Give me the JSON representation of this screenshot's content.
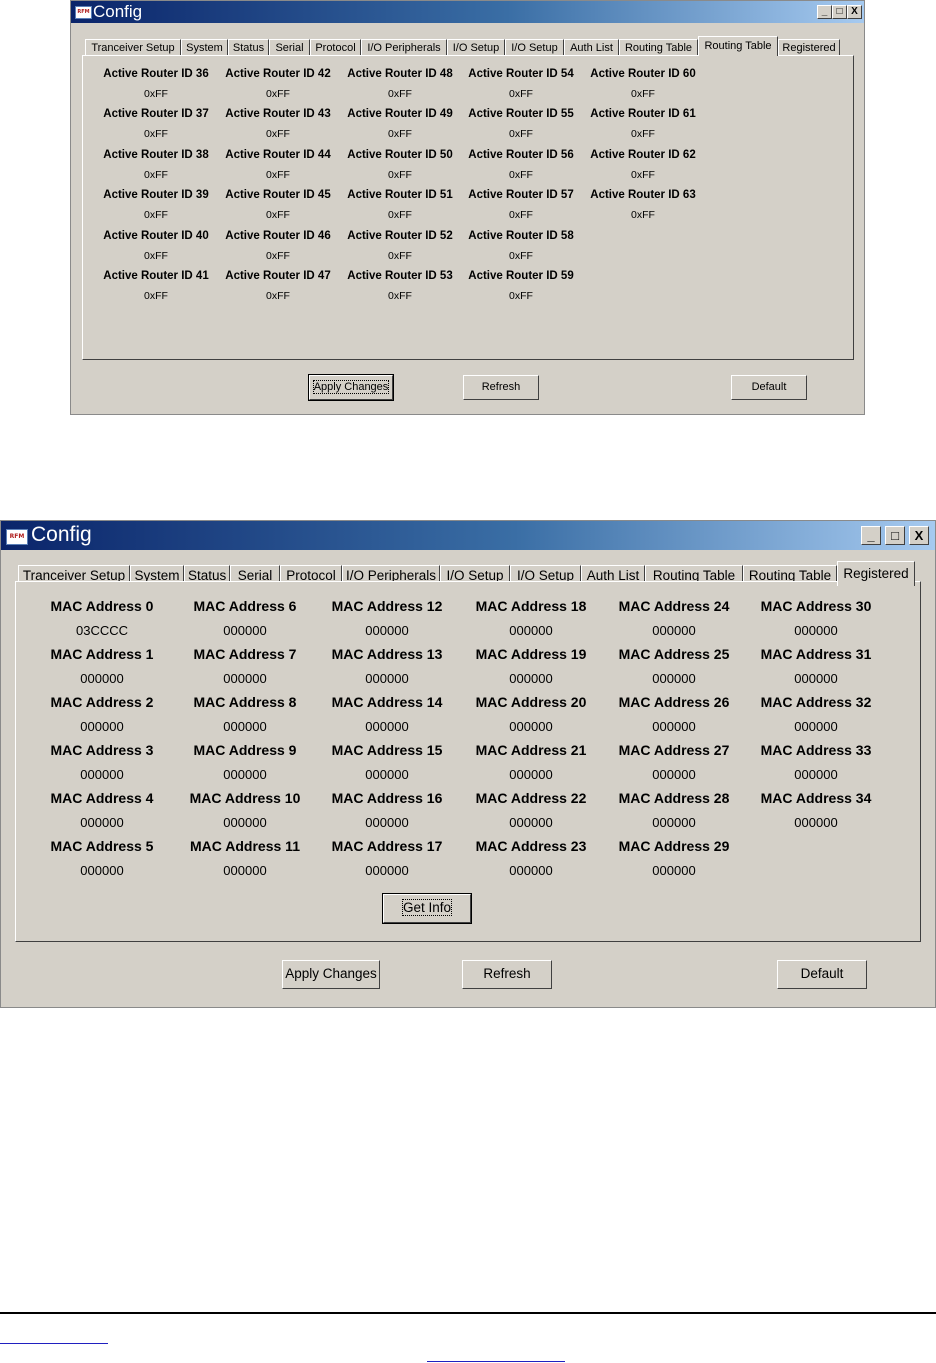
{
  "window1": {
    "title": "Config",
    "icon_label": "RFM",
    "controls": {
      "minimize": "_",
      "maximize": "□",
      "close": "X"
    },
    "tabs": [
      "Tranceiver Setup",
      "System",
      "Status",
      "Serial",
      "Protocol",
      "I/O Peripherals",
      "I/O Setup",
      "I/O Setup",
      "Auth List",
      "Routing Table",
      "Routing Table",
      "Registered"
    ],
    "active_tab_index": 10,
    "routers": [
      {
        "label": "Active Router ID 36",
        "value": "0xFF"
      },
      {
        "label": "Active Router ID 37",
        "value": "0xFF"
      },
      {
        "label": "Active Router ID 38",
        "value": "0xFF"
      },
      {
        "label": "Active Router ID 39",
        "value": "0xFF"
      },
      {
        "label": "Active Router ID 40",
        "value": "0xFF"
      },
      {
        "label": "Active Router ID 41",
        "value": "0xFF"
      },
      {
        "label": "Active Router ID 42",
        "value": "0xFF"
      },
      {
        "label": "Active Router ID 43",
        "value": "0xFF"
      },
      {
        "label": "Active Router ID 44",
        "value": "0xFF"
      },
      {
        "label": "Active Router ID 45",
        "value": "0xFF"
      },
      {
        "label": "Active Router ID 46",
        "value": "0xFF"
      },
      {
        "label": "Active Router ID 47",
        "value": "0xFF"
      },
      {
        "label": "Active Router ID 48",
        "value": "0xFF"
      },
      {
        "label": "Active Router ID 49",
        "value": "0xFF"
      },
      {
        "label": "Active Router ID 50",
        "value": "0xFF"
      },
      {
        "label": "Active Router ID 51",
        "value": "0xFF"
      },
      {
        "label": "Active Router ID 52",
        "value": "0xFF"
      },
      {
        "label": "Active Router ID 53",
        "value": "0xFF"
      },
      {
        "label": "Active Router ID 54",
        "value": "0xFF"
      },
      {
        "label": "Active Router ID 55",
        "value": "0xFF"
      },
      {
        "label": "Active Router ID 56",
        "value": "0xFF"
      },
      {
        "label": "Active Router ID 57",
        "value": "0xFF"
      },
      {
        "label": "Active Router ID 58",
        "value": "0xFF"
      },
      {
        "label": "Active Router ID 59",
        "value": "0xFF"
      },
      {
        "label": "Active Router ID 60",
        "value": "0xFF"
      },
      {
        "label": "Active Router ID 61",
        "value": "0xFF"
      },
      {
        "label": "Active Router ID 62",
        "value": "0xFF"
      },
      {
        "label": "Active Router ID 63",
        "value": "0xFF"
      }
    ],
    "buttons": {
      "apply": "Apply Changes",
      "refresh": "Refresh",
      "default": "Default"
    }
  },
  "window2": {
    "title": "Config",
    "icon_label": "RFM",
    "controls": {
      "minimize": "_",
      "maximize": "□",
      "close": "X"
    },
    "tabs": [
      "Tranceiver Setup",
      "System",
      "Status",
      "Serial",
      "Protocol",
      "I/O Peripherals",
      "I/O Setup",
      "I/O Setup",
      "Auth List",
      "Routing Table",
      "Routing Table",
      "Registered"
    ],
    "active_tab_index": 11,
    "macs": [
      {
        "label": "MAC Address 0",
        "value": "03CCCC"
      },
      {
        "label": "MAC Address 1",
        "value": "000000"
      },
      {
        "label": "MAC Address 2",
        "value": "000000"
      },
      {
        "label": "MAC Address 3",
        "value": "000000"
      },
      {
        "label": "MAC Address 4",
        "value": "000000"
      },
      {
        "label": "MAC Address 5",
        "value": "000000"
      },
      {
        "label": "MAC Address 6",
        "value": "000000"
      },
      {
        "label": "MAC Address 7",
        "value": "000000"
      },
      {
        "label": "MAC Address 8",
        "value": "000000"
      },
      {
        "label": "MAC Address 9",
        "value": "000000"
      },
      {
        "label": "MAC Address 10",
        "value": "000000"
      },
      {
        "label": "MAC Address 11",
        "value": "000000"
      },
      {
        "label": "MAC Address 12",
        "value": "000000"
      },
      {
        "label": "MAC Address 13",
        "value": "000000"
      },
      {
        "label": "MAC Address 14",
        "value": "000000"
      },
      {
        "label": "MAC Address 15",
        "value": "000000"
      },
      {
        "label": "MAC Address 16",
        "value": "000000"
      },
      {
        "label": "MAC Address 17",
        "value": "000000"
      },
      {
        "label": "MAC Address 18",
        "value": "000000"
      },
      {
        "label": "MAC Address 19",
        "value": "000000"
      },
      {
        "label": "MAC Address 20",
        "value": "000000"
      },
      {
        "label": "MAC Address 21",
        "value": "000000"
      },
      {
        "label": "MAC Address 22",
        "value": "000000"
      },
      {
        "label": "MAC Address 23",
        "value": "000000"
      },
      {
        "label": "MAC Address 24",
        "value": "000000"
      },
      {
        "label": "MAC Address 25",
        "value": "000000"
      },
      {
        "label": "MAC Address 26",
        "value": "000000"
      },
      {
        "label": "MAC Address 27",
        "value": "000000"
      },
      {
        "label": "MAC Address 28",
        "value": "000000"
      },
      {
        "label": "MAC Address 29",
        "value": "000000"
      },
      {
        "label": "MAC Address 30",
        "value": "000000"
      },
      {
        "label": "MAC Address 31",
        "value": "000000"
      },
      {
        "label": "MAC Address 32",
        "value": "000000"
      },
      {
        "label": "MAC Address 33",
        "value": "000000"
      },
      {
        "label": "MAC Address 34",
        "value": "000000"
      }
    ],
    "get_info": "Get Info",
    "buttons": {
      "apply": "Apply Changes",
      "refresh": "Refresh",
      "default": "Default"
    }
  }
}
